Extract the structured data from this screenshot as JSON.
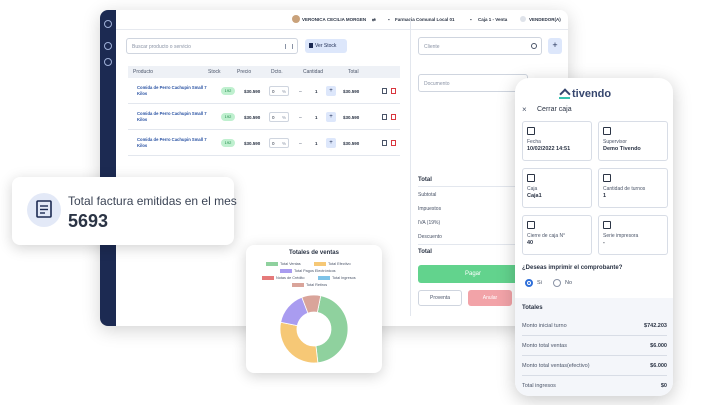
{
  "pos": {
    "top_bar": {
      "user": "VERONICA CECILIA MORGEN",
      "store": "Farmacia Comunal Local 01",
      "register": "Caja 1 - Venta",
      "role": "VENDEDOR(A)"
    },
    "search_placeholder": "Buscar producto o servicio",
    "stock_button": "Ver Stock",
    "columns": [
      "Producto",
      "Stock",
      "Precio",
      "Dcto.",
      "Cantidad",
      "Total"
    ],
    "rows": [
      {
        "name": "Comida de Perro Cachupin Small 7 Kilos",
        "stock": "192",
        "price": "$30.590",
        "discount": "0",
        "discount_unit": "%",
        "minus": "–",
        "qty": "1",
        "plus": "+",
        "total": "$30.590"
      },
      {
        "name": "Comida de Perro Cachupin Small 7 Kilos",
        "stock": "192",
        "price": "$30.590",
        "discount": "0",
        "discount_unit": "%",
        "minus": "–",
        "qty": "1",
        "plus": "+",
        "total": "$30.590"
      },
      {
        "name": "Comida de Perro Cachupin Small 7 Kilos",
        "stock": "192",
        "price": "$30.590",
        "discount": "0",
        "discount_unit": "%",
        "minus": "–",
        "qty": "1",
        "plus": "+",
        "total": "$30.590"
      }
    ],
    "client_placeholder": "Cliente",
    "client_add": "+",
    "document_placeholder": "Documento",
    "totals": {
      "total": "Total",
      "subtotal": "Subtotal",
      "impuestos": "Impuestos",
      "iva": "IVA (19%)",
      "descuento": "Descuento",
      "total2": "Total"
    },
    "pay_button": "Pagar",
    "proventa_button": "Proventa",
    "anular_button": "Anular"
  },
  "facturas_card": {
    "title": "Total factura emitidas en el mes",
    "value": "5693"
  },
  "sales_chart": {
    "title": "Totales de ventas",
    "legend": [
      "Total Ventas",
      "Total Efectivo",
      "Total Pagos Electrónicos",
      "Notas de Crédito",
      "Total Ingresos",
      "Total Retiros"
    ],
    "colors": [
      "#8fd19e",
      "#f6c876",
      "#a99cf0",
      "#e57a7a",
      "#7ec3e8",
      "#d9a49a"
    ]
  },
  "chart_data": {
    "type": "pie",
    "title": "Totales de ventas",
    "categories": [
      "Total Ventas",
      "Total Efectivo",
      "Total Pagos Electrónicos",
      "Notas de Crédito",
      "Total Ingresos",
      "Total Retiros"
    ],
    "values": [
      45,
      30,
      16,
      0,
      0,
      9
    ]
  },
  "phone": {
    "logo": "tivendo",
    "close": "×",
    "title": "Cerrar caja",
    "tiles": [
      {
        "label": "Fecha",
        "value": "10/02/2022 14:51"
      },
      {
        "label": "Supervisor",
        "value": "Demo Tivendo"
      },
      {
        "label": "Caja",
        "value": "Caja1"
      },
      {
        "label": "Cantidad de turnos",
        "value": "1"
      },
      {
        "label": "Cierre de caja N°",
        "value": "40"
      },
      {
        "label": "Serie impresora",
        "value": "-"
      }
    ],
    "question": "¿Deseas imprimir el comprobante?",
    "yes": "Si",
    "no": "No",
    "totals_title": "Totales",
    "totals": [
      {
        "label": "Monto inicial turno",
        "value": "$742.203"
      },
      {
        "label": "Monto total ventas",
        "value": "$6.000"
      },
      {
        "label": "Monto total ventas(efectivo)",
        "value": "$6.000"
      },
      {
        "label": "Total ingresos",
        "value": "$0"
      }
    ]
  }
}
